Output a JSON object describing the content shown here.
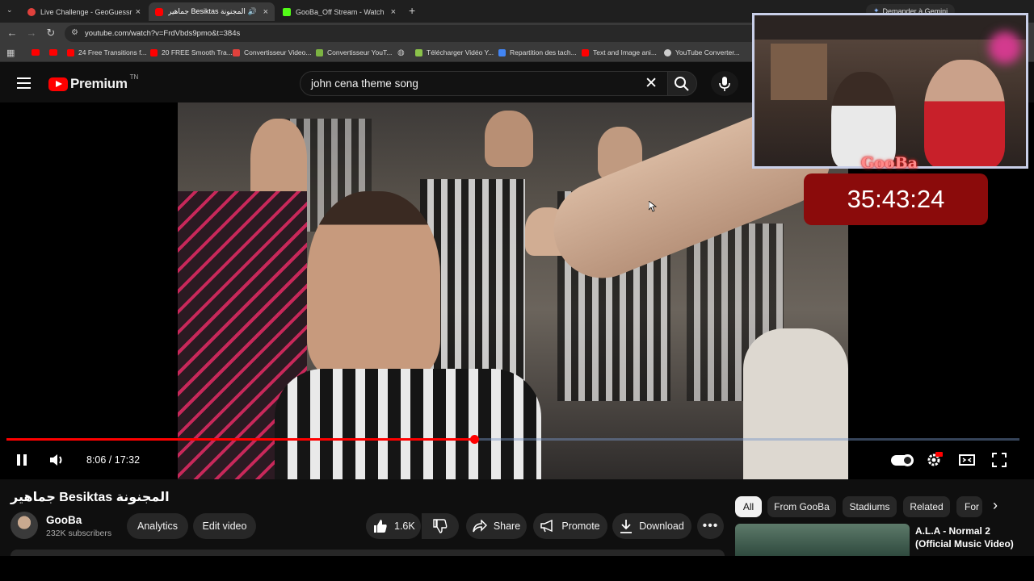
{
  "browser": {
    "tabs": [
      {
        "title": "Live Challenge - GeoGuessr",
        "favicon_color": "#e0413c"
      },
      {
        "title": "جماهير Besiktas المجنونة",
        "favicon_color": "#ff0000",
        "active": true
      },
      {
        "title": "GooBa_Off Stream - Watch Live",
        "favicon_color": "#53fc18"
      }
    ],
    "url": "youtube.com/watch?v=FrdVbds9pmo&t=384s",
    "gemini_label": "Demander à Gemini",
    "bookmarks": [
      "24 Free Transitions f...",
      "20 FREE Smooth Tra...",
      "Convertisseur Video...",
      "Convertisseur YouT...",
      "Télécharger Vidéo Y...",
      "Repartition des tach...",
      "Text and Image ani...",
      "YouTube Converter..."
    ]
  },
  "youtube": {
    "logo_text": "Premium",
    "logo_sup": "TN",
    "search_query": "john cena theme song"
  },
  "player": {
    "current_time": "8:06",
    "duration": "17:32",
    "time_display": "8:06 / 17:32",
    "progress_fraction": 0.462
  },
  "overlay": {
    "streamer_tag": "GooBa",
    "timer": "35:43:24"
  },
  "video": {
    "title": "جماهير Besiktas المجنونة",
    "channel": "GooBa",
    "subscribers": "232K subscribers",
    "analytics_label": "Analytics",
    "edit_label": "Edit video",
    "likes": "1.6K",
    "share_label": "Share",
    "promote_label": "Promote",
    "download_label": "Download"
  },
  "chips": [
    "All",
    "From GooBa",
    "Stadiums",
    "Related",
    "For"
  ],
  "recommended": {
    "title": "A.L.A - Normal 2 (Official Music Video)"
  }
}
